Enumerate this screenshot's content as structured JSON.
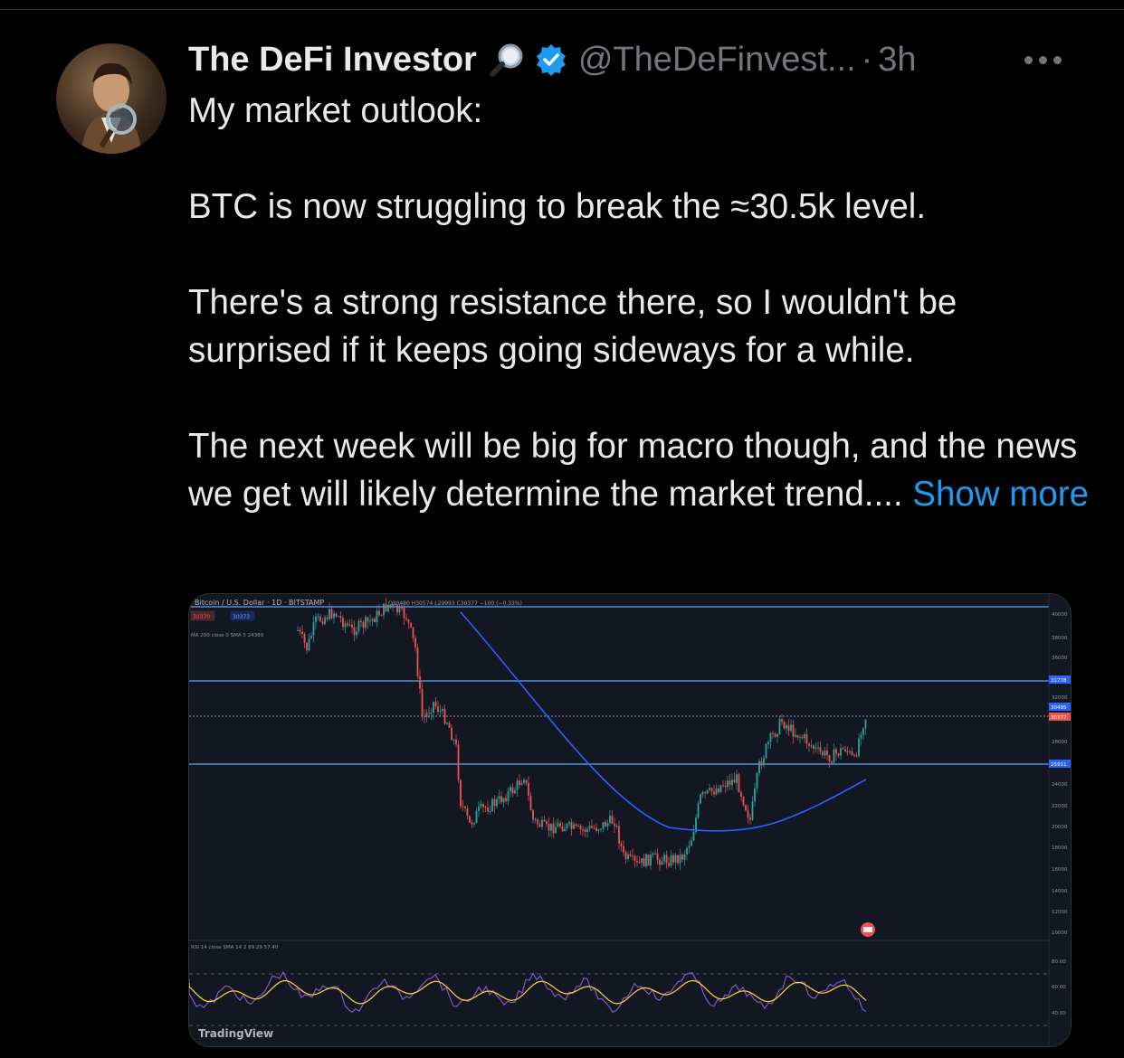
{
  "tweet": {
    "author_name": "The DeFi Investor",
    "author_emoji_icon": "magnifying-glass-icon",
    "verified": true,
    "handle": "@TheDeFinvest...",
    "separator": "·",
    "time": "3h",
    "paragraphs": [
      "My market outlook:",
      "BTC is now struggling to break the ≈30.5k level.",
      "There's a strong resistance there, so I wouldn't be surprised if it keeps going sideways for a while.",
      "The next week will be big for macro though, and the news we get will likely determine the market trend...."
    ],
    "show_more_label": "Show more",
    "more_icon": "more-horizontal-icon"
  },
  "chart": {
    "header_label": "Bitcoin / U.S. Dollar · 1D · BITSTAMP",
    "ohlc_label": "O30480 H30574 L29993 C30377 −100 (−0.33%)",
    "bid_label": "30370",
    "ask_label": "30373",
    "ma_label": "MA 200 close 0 SMA 5  24389",
    "rsi_label": "RSI 14 close SMA 14 2  69.29  57.40",
    "watermark": "TradingView",
    "price_axis": [
      "40000",
      "38000",
      "36000",
      "32000",
      "28000",
      "24000",
      "22000",
      "20000",
      "18000",
      "16000",
      "14000",
      "12000",
      "10000"
    ],
    "level_tags": [
      "31778",
      "30495",
      "30377",
      "25911"
    ],
    "rsi_axis": [
      "80.00",
      "60.00",
      "40.00"
    ],
    "colors": {
      "background": "#131722",
      "up": "#26a69a",
      "down": "#ef5350",
      "ma": "#2962ff",
      "rsi": "#7e57c2",
      "rsi_ma": "#fdd835",
      "level": "#4f8fd8"
    }
  }
}
